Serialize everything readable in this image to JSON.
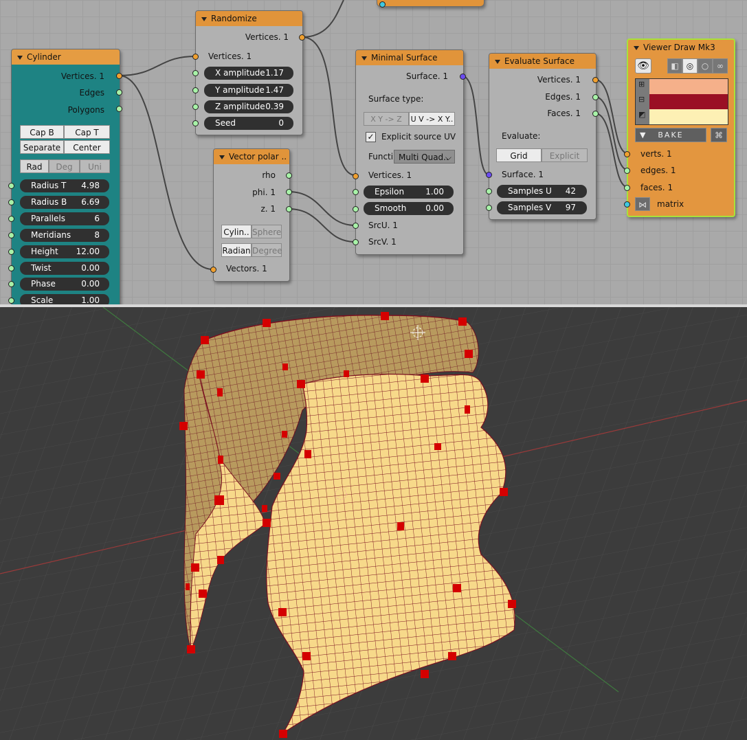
{
  "colors": {
    "node_header": "#e1943a",
    "node_body": "#b1b1b1",
    "cylinder_body": "#1e8383",
    "viewer_body": "#e3963f",
    "viewer_outline": "#a8e23a",
    "mesh_fill": "#f7d98a",
    "mesh_edge": "#7a1020",
    "vertex_marker": "#d40000",
    "vertex_color": "#f5b08a",
    "edge_color": "#9a0f24",
    "face_color": "#fdf0b4"
  },
  "cylinder": {
    "title": "Cylinder",
    "outputs": [
      "Vertices. 1",
      "Edges",
      "Polygons"
    ],
    "cap_buttons": [
      "Cap B",
      "Cap T"
    ],
    "separate_label": "Separate",
    "center_label": "Center",
    "units": [
      "Rad",
      "Deg",
      "Uni"
    ],
    "fields": [
      {
        "label": "Radius T",
        "value": "4.98"
      },
      {
        "label": "Radius B",
        "value": "6.69"
      },
      {
        "label": "Parallels",
        "value": "6"
      },
      {
        "label": "Meridians",
        "value": "8"
      },
      {
        "label": "Height",
        "value": "12.00"
      },
      {
        "label": "Twist",
        "value": "0.00"
      },
      {
        "label": "Phase",
        "value": "0.00"
      },
      {
        "label": "Scale",
        "value": "1.00"
      }
    ]
  },
  "randomize": {
    "title": "Randomize",
    "output": "Vertices. 1",
    "input": "Vertices. 1",
    "fields": [
      {
        "label": "X amplitude",
        "value": "1.17"
      },
      {
        "label": "Y amplitude",
        "value": "1.47"
      },
      {
        "label": "Z amplitude",
        "value": "0.39"
      },
      {
        "label": "Seed",
        "value": "0"
      }
    ]
  },
  "vector_polar": {
    "title": "Vector polar ..",
    "outputs": [
      "rho",
      "phi. 1",
      "z. 1"
    ],
    "coords": [
      "Cylin..",
      "Sphere"
    ],
    "angles": [
      "Radian",
      "Degree"
    ],
    "input": "Vectors. 1"
  },
  "minimal_surface": {
    "title": "Minimal Surface",
    "output": "Surface. 1",
    "surface_type_label": "Surface type:",
    "types": [
      "X Y -> Z",
      "U V -> X Y.."
    ],
    "explicit_uv_label": "Explicit source UV",
    "function_label": "Functi",
    "function_value": "Multi Quad..",
    "vertices_input": "Vertices. 1",
    "fields": [
      {
        "label": "Epsilon",
        "value": "1.00"
      },
      {
        "label": "Smooth",
        "value": "0.00"
      }
    ],
    "inputs": [
      "SrcU. 1",
      "SrcV. 1"
    ]
  },
  "evaluate_surface": {
    "title": "Evaluate Surface",
    "outputs": [
      "Vertices. 1",
      "Edges. 1",
      "Faces. 1"
    ],
    "evaluate_label": "Evaluate:",
    "modes": [
      "Grid",
      "Explicit"
    ],
    "surface_input": "Surface. 1",
    "fields": [
      {
        "label": "Samples U",
        "value": "42"
      },
      {
        "label": "Samples V",
        "value": "97"
      }
    ]
  },
  "viewer": {
    "title": "Viewer Draw Mk3",
    "bake_label": "BAKE",
    "inputs": [
      "verts. 1",
      "edges. 1",
      "faces. 1",
      "matrix"
    ]
  }
}
